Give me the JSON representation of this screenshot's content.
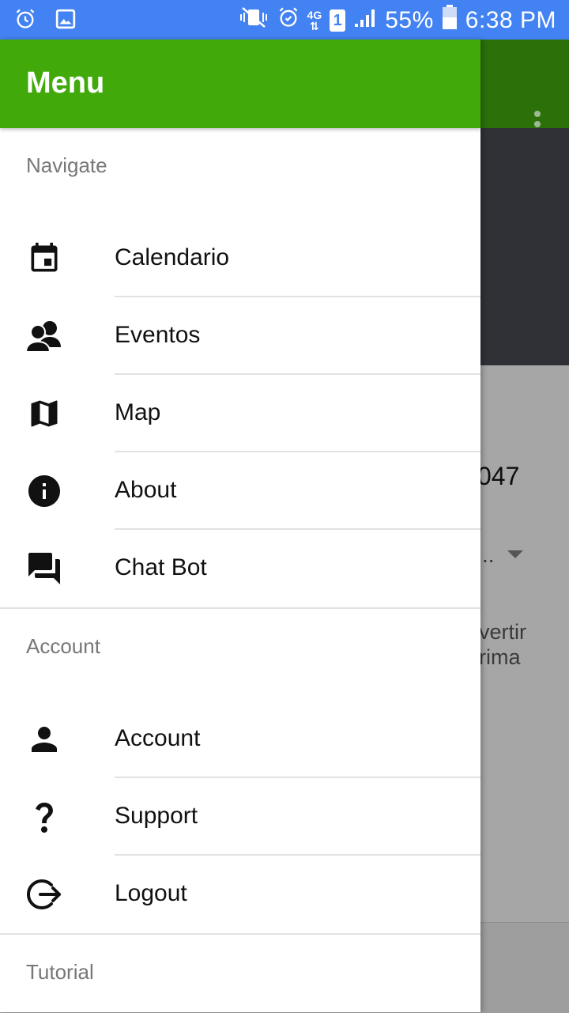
{
  "status_bar": {
    "battery": "55%",
    "time": "6:38 PM",
    "network": "4G",
    "sim": "1"
  },
  "background": {
    "partial_number": "047",
    "partial_dropdown": "..",
    "partial_line1": "vertir",
    "partial_line2": "rima"
  },
  "drawer": {
    "title": "Menu",
    "sections": [
      {
        "label": "Navigate",
        "items": [
          {
            "label": "Calendario",
            "icon": "calendar-icon"
          },
          {
            "label": "Eventos",
            "icon": "people-icon"
          },
          {
            "label": "Map",
            "icon": "map-icon"
          },
          {
            "label": "About",
            "icon": "info-icon"
          },
          {
            "label": "Chat Bot",
            "icon": "chat-icon"
          }
        ]
      },
      {
        "label": "Account",
        "items": [
          {
            "label": "Account",
            "icon": "person-icon"
          },
          {
            "label": "Support",
            "icon": "help-icon"
          },
          {
            "label": "Logout",
            "icon": "logout-icon"
          }
        ]
      },
      {
        "label": "Tutorial",
        "items": []
      }
    ]
  },
  "colors": {
    "status_bar": "#4382f2",
    "header": "#41aa0a",
    "toolbar_behind": "#2c700a"
  }
}
